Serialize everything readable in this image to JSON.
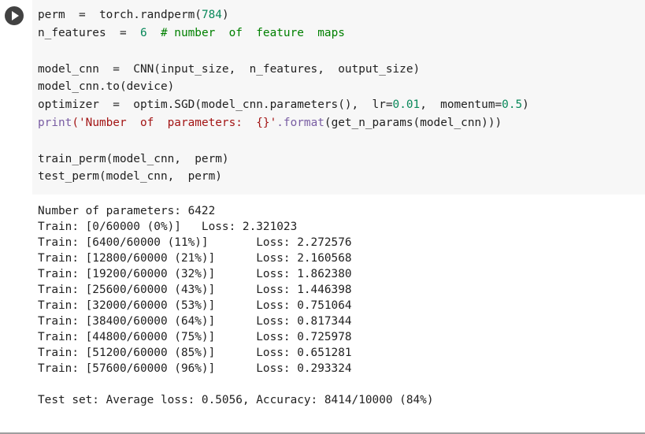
{
  "cell": {
    "run_icon": "play-icon",
    "code": {
      "line1_a": "perm  =  torch.randperm(",
      "line1_b": "784",
      "line1_c": ")",
      "line2_a": "n_features  =  ",
      "line2_b": "6",
      "line2_c": "  # number  of  feature  maps",
      "line3": "model_cnn  =  CNN(input_size,  n_features,  output_size)",
      "line4": "model_cnn.to(device)",
      "line5_a": "optimizer  =  optim.SGD(model_cnn.parameters(),  lr=",
      "line5_b": "0.01",
      "line5_c": ",  momentum=",
      "line5_d": "0.5",
      "line5_e": ")",
      "line6_a": "print",
      "line6_b": "('Number  of  parameters:  {}'",
      "line6_c": ".format",
      "line6_d": "(get_n_params(model_cnn)))",
      "line7": "train_perm(model_cnn,  perm)",
      "line8": "test_perm(model_cnn,  perm)"
    }
  },
  "output": {
    "lines": [
      "Number of parameters: 6422",
      "Train: [0/60000 (0%)]   Loss: 2.321023",
      "Train: [6400/60000 (11%)]       Loss: 2.272576",
      "Train: [12800/60000 (21%)]      Loss: 2.160568",
      "Train: [19200/60000 (32%)]      Loss: 1.862380",
      "Train: [25600/60000 (43%)]      Loss: 1.446398",
      "Train: [32000/60000 (53%)]      Loss: 0.751064",
      "Train: [38400/60000 (64%)]      Loss: 0.817344",
      "Train: [44800/60000 (75%)]      Loss: 0.725978",
      "Train: [51200/60000 (85%)]      Loss: 0.651281",
      "Train: [57600/60000 (96%)]      Loss: 0.293324",
      "",
      "Test set: Average loss: 0.5056, Accuracy: 8414/10000 (84%)"
    ]
  },
  "colors": {
    "editor_bg": "#f7f7f7",
    "run_button": "#424242",
    "number": "#09885a",
    "string": "#a31515",
    "comment": "#008000",
    "builtin": "#795da3"
  }
}
